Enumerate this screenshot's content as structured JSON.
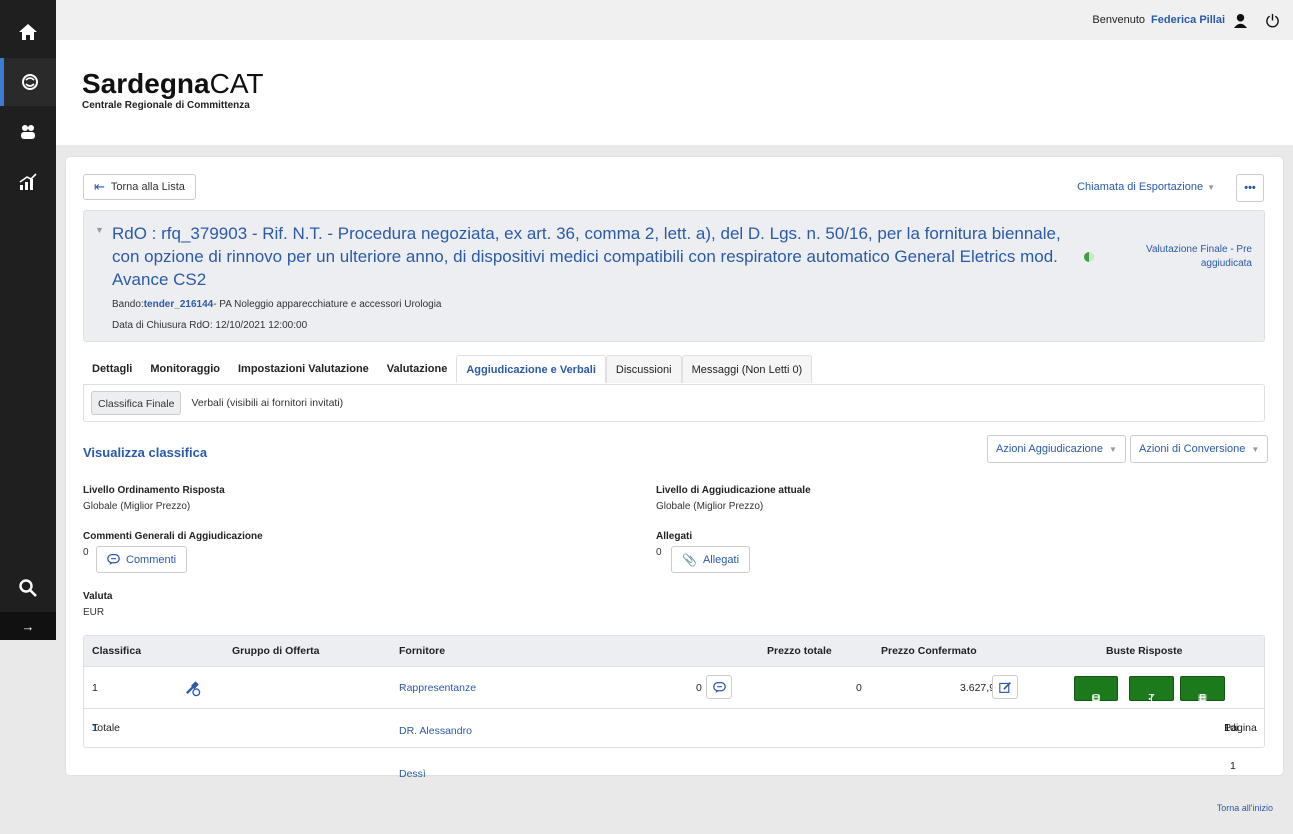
{
  "topbar": {
    "welcome": "Benvenuto",
    "user_name": "Federica Pillai"
  },
  "logo": {
    "name_bold": "Sardegna",
    "name_light": "CAT",
    "subtitle": "Centrale Regionale di Committenza"
  },
  "toolbar": {
    "back_label": "Torna alla Lista",
    "export_label": "Chiamata di Esportazione",
    "more_label": "•••"
  },
  "header": {
    "title": "RdO : rfq_379903 - Rif. N.T. - Procedura negoziata, ex art. 36, comma 2, lett. a), del D. Lgs. n. 50/16, per la fornitura biennale, con opzione di rinnovo per un ulteriore anno, di dispositivi medici compatibili con respiratore automatico General Eletrics mod. Avance CS2",
    "bando_label": "Bando:",
    "bando_code": "tender_216144",
    "bando_desc": "- PA Noleggio apparecchiature e accessori Urologia",
    "chiusura": "Data di Chiusura RdO: 12/10/2021 12:00:00",
    "status": "Valutazione Finale - Pre aggiudicata"
  },
  "tabs": [
    {
      "label": "Dettagli"
    },
    {
      "label": "Monitoraggio"
    },
    {
      "label": "Impostazioni Valutazione"
    },
    {
      "label": "Valutazione"
    },
    {
      "label": "Aggiudicazione e Verbali"
    },
    {
      "label": "Discussioni"
    },
    {
      "label": "Messaggi (Non Letti 0)"
    }
  ],
  "subtabs": [
    {
      "label": "Classifica Finale"
    },
    {
      "label": "Verbali (visibili ai fornitori invitati)"
    }
  ],
  "section": {
    "title": "Visualizza classifica",
    "action1": "Azioni Aggiudicazione",
    "action2": "Azioni di Conversione"
  },
  "fields": {
    "livello_ord_label": "Livello Ordinamento Risposta",
    "livello_ord_value": "Globale (Miglior Prezzo)",
    "livello_agg_label": "Livello di Aggiudicazione attuale",
    "livello_agg_value": "Globale (Miglior Prezzo)",
    "commenti_label": "Commenti Generali di Aggiudicazione",
    "commenti_count": "0",
    "commenti_btn": "Commenti",
    "allegati_label": "Allegati",
    "allegati_count": "0",
    "allegati_btn": "Allegati",
    "valuta_label": "Valuta",
    "valuta_value": "EUR"
  },
  "table": {
    "headers": {
      "classifica": "Classifica",
      "gruppo": "Gruppo di Offerta",
      "fornitore": "Fornitore",
      "prezzo_totale": "Prezzo totale",
      "prezzo_confermato": "Prezzo Confermato",
      "buste": "Buste Risposte"
    },
    "row": {
      "classifica": "1",
      "fornitore": "Rappresentanze DR. Alessandro Dessì",
      "messages": "0",
      "prezzo_totale": "0",
      "prezzo_confermato": "3.627,92",
      "busta_q": "Q",
      "busta_t": "T",
      "busta_e": "E"
    },
    "footer": {
      "totale_label": "Totale",
      "totale_value": "1",
      "pagina_label": "Pagina",
      "pagina_current": "1",
      "pagina_of": "di 1"
    }
  },
  "footer": {
    "top_link": "Torna all'inizio"
  }
}
